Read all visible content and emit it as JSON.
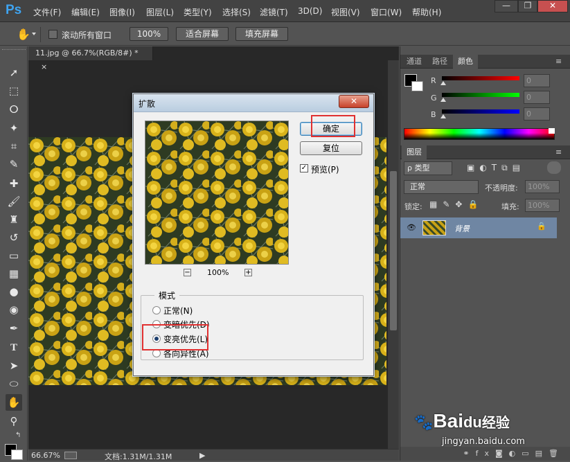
{
  "app": {
    "logo": "Ps"
  },
  "menu": [
    "文件(F)",
    "编辑(E)",
    "图像(I)",
    "图层(L)",
    "类型(Y)",
    "选择(S)",
    "滤镜(T)",
    "3D(D)",
    "视图(V)",
    "窗口(W)",
    "帮助(H)"
  ],
  "window_controls": {
    "minimize": "—",
    "restore": "❐",
    "close": "✕"
  },
  "options": {
    "scroll_all_label": "滚动所有窗口",
    "zoom_btn": "100%",
    "fit_screen_btn": "适合屏幕",
    "fill_screen_btn": "填充屏幕"
  },
  "document": {
    "tab_title": "11.jpg @ 66.7%(RGB/8#) *",
    "tab_close": "×",
    "zoom": "66.67%",
    "status": "文档:1.31M/1.31M"
  },
  "color_panel": {
    "tabs": [
      "通道",
      "路径",
      "颜色"
    ],
    "active_tab": "颜色",
    "channels": [
      {
        "label": "R",
        "value": "0",
        "color": "#ff0000"
      },
      {
        "label": "G",
        "value": "0",
        "color": "#00ff00"
      },
      {
        "label": "B",
        "value": "0",
        "color": "#0000ff"
      }
    ]
  },
  "layers_panel": {
    "tab": "图层",
    "filter_label": "ρ 类型",
    "blend_mode": "正常",
    "opacity_label": "不透明度:",
    "opacity_value": "100%",
    "lock_label": "锁定:",
    "fill_label": "填充:",
    "fill_value": "100%",
    "layer_name": "背景"
  },
  "dialog": {
    "title": "扩散",
    "close": "✕",
    "ok": "确定",
    "reset": "复位",
    "preview_label": "预览(P)",
    "preview_checked": true,
    "zoom_minus": "−",
    "zoom_plus": "+",
    "preview_zoom": "100%",
    "mode_legend": "模式",
    "modes": [
      {
        "label": "正常(N)",
        "selected": false
      },
      {
        "label": "变暗优先(D)",
        "selected": false
      },
      {
        "label": "变亮优先(L)",
        "selected": true
      },
      {
        "label": "各向异性(A)",
        "selected": false
      }
    ]
  },
  "watermark": {
    "brand": "Bai",
    "brand2": "du",
    "brand3": "经验",
    "url": "jingyan.baidu.com"
  }
}
